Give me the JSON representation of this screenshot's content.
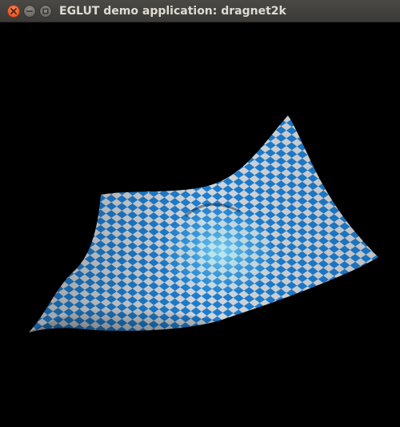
{
  "window": {
    "title": "EGLUT demo application: dragnet2k"
  },
  "controls": [
    "close",
    "minimize",
    "maximize"
  ],
  "colors": {
    "background": "#000000",
    "titlebar": "#3c3b37",
    "title_text": "#dfdbd2",
    "checker_blue": "#1e7ed0",
    "checker_light": "#d2d6da",
    "close_button": "#e95420"
  }
}
